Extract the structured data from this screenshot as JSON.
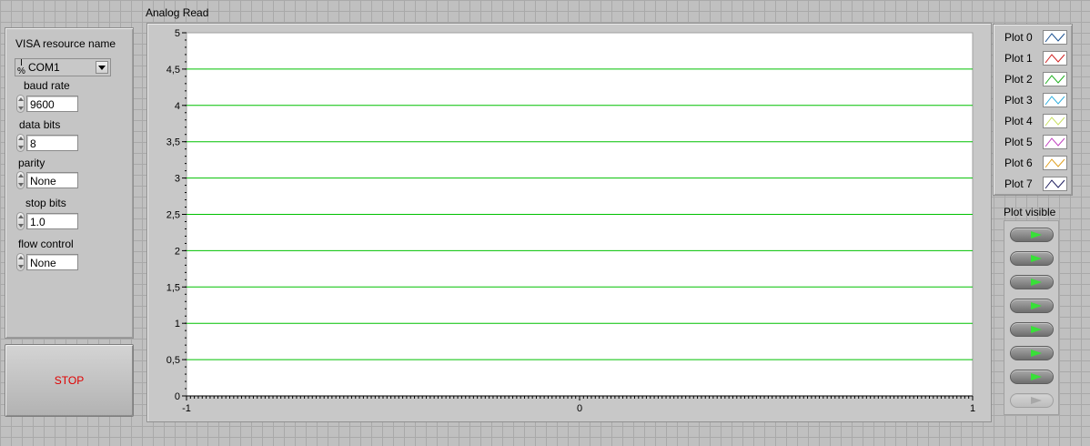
{
  "visa": {
    "label": "VISA resource name",
    "value": "COM1",
    "icon": "visa-io-icon"
  },
  "serial": {
    "baud_label": "baud rate",
    "baud_value": "9600",
    "data_bits_label": "data bits",
    "data_bits_value": "8",
    "parity_label": "parity",
    "parity_value": "None",
    "stop_bits_label": "stop bits",
    "stop_bits_value": "1.0",
    "flow_label": "flow control",
    "flow_value": "None"
  },
  "stop_button": {
    "label": "STOP",
    "color": "#e00000"
  },
  "chart": {
    "title": "Analog Read",
    "background": "#ffffff",
    "grid_color": "#00c000"
  },
  "chart_data": {
    "type": "line",
    "title": "Analog Read",
    "xlabel": "",
    "ylabel": "",
    "xlim": [
      -1,
      1
    ],
    "ylim": [
      0,
      5
    ],
    "x_ticks": [
      "-1",
      "0",
      "1"
    ],
    "y_ticks": [
      "0",
      "0,5",
      "1",
      "1,5",
      "2",
      "2,5",
      "3",
      "3,5",
      "4",
      "4,5",
      "5"
    ],
    "grid": "horizontal",
    "series": [
      {
        "name": "Plot 0",
        "color": "#1a5090",
        "values": []
      },
      {
        "name": "Plot 1",
        "color": "#d02020",
        "values": []
      },
      {
        "name": "Plot 2",
        "color": "#20b020",
        "values": []
      },
      {
        "name": "Plot 3",
        "color": "#30b0e0",
        "values": []
      },
      {
        "name": "Plot 4",
        "color": "#c8e060",
        "values": []
      },
      {
        "name": "Plot 5",
        "color": "#c040c0",
        "values": []
      },
      {
        "name": "Plot 6",
        "color": "#e0a020",
        "values": []
      },
      {
        "name": "Plot 7",
        "color": "#202060",
        "values": []
      }
    ],
    "legend": "right"
  },
  "plot_visible": {
    "label": "Plot visible",
    "states": [
      true,
      true,
      true,
      true,
      true,
      true,
      true,
      false
    ]
  }
}
